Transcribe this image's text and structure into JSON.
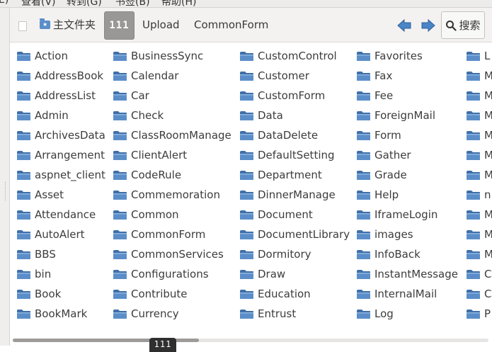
{
  "menubar": {
    "items": [
      "E)",
      "查看(V)",
      "转到(G)",
      "书签(B)",
      "帮助(H)"
    ]
  },
  "toolbar": {
    "home_label": "主文件夹",
    "active_crumb": "111",
    "crumbs": [
      "Upload",
      "CommonForm"
    ],
    "search_label": "搜索"
  },
  "files": {
    "columns": [
      [
        "Action",
        "AddressBook",
        "AddressList",
        "Admin",
        "ArchivesData",
        "Arrangement",
        "aspnet_client",
        "Asset",
        "Attendance",
        "AutoAlert",
        "BBS",
        "bin",
        "Book",
        "BookMark"
      ],
      [
        "BusinessSync",
        "Calendar",
        "Car",
        "Check",
        "ClassRoomManage",
        "ClientAlert",
        "CodeRule",
        "Commemoration",
        "Common",
        "CommonForm",
        "CommonServices",
        "Configurations",
        "Contribute",
        "Currency"
      ],
      [
        "CustomControl",
        "Customer",
        "CustomForm",
        "Data",
        "DataDelete",
        "DefaultSetting",
        "Department",
        "DinnerManage",
        "Document",
        "DocumentLibrary",
        "Dormitory",
        "Draw",
        "Education",
        "Entrust"
      ],
      [
        "Favorites",
        "Fax",
        "Fee",
        "ForeignMail",
        "Form",
        "Gather",
        "Grade",
        "Help",
        "IframeLogin",
        "images",
        "InfoBack",
        "InstantMessage",
        "InternalMail",
        "Log"
      ],
      [
        "L",
        "M",
        "M",
        "M",
        "M",
        "M",
        "M",
        "n",
        "M",
        "M",
        "M",
        "C",
        "C",
        "P"
      ]
    ]
  },
  "tooltip": {
    "text": "111"
  },
  "colors": {
    "folder": "#5b8ec9",
    "folder_dark": "#3f6fa8",
    "arrow": "#4a85c8",
    "active_crumb_bg": "#9a9896"
  }
}
